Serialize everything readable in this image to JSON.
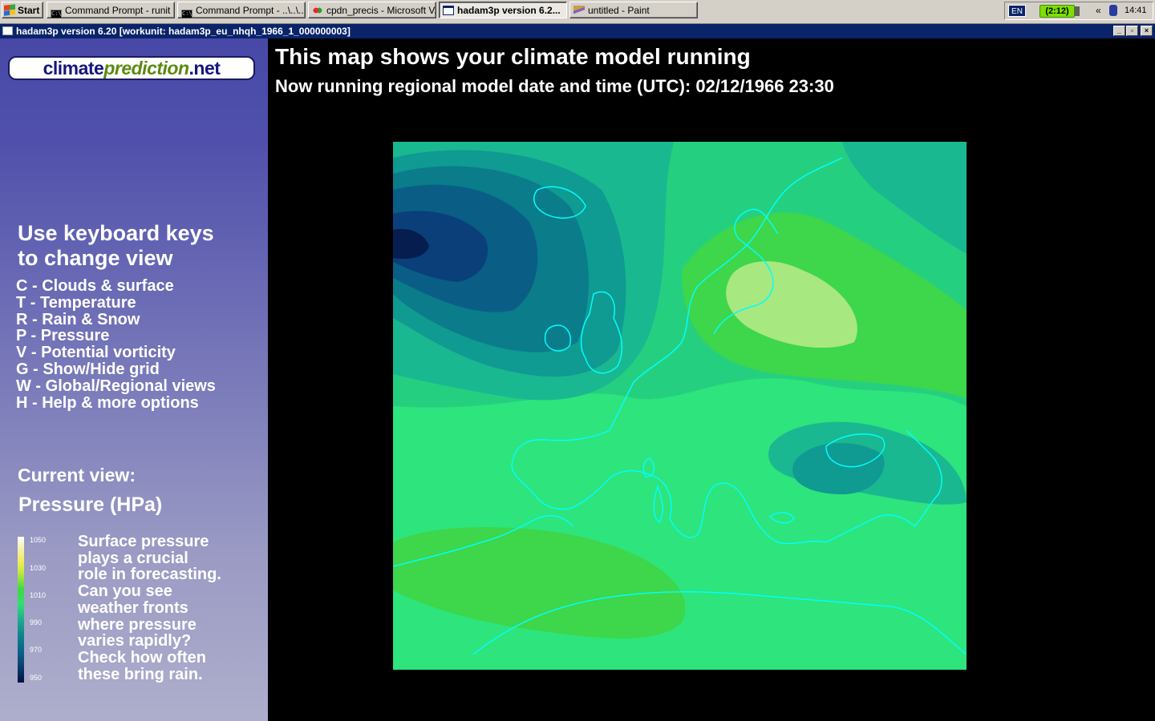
{
  "taskbar": {
    "start_label": "Start",
    "items": [
      {
        "label": "Command Prompt - runit",
        "icon": "cmd-icon"
      },
      {
        "label": "Command Prompt - ..\\..\\...",
        "icon": "cmd-icon"
      },
      {
        "label": "cpdn_precis - Microsoft V...",
        "icon": "app-icon"
      },
      {
        "label": "hadam3p version 6.2...",
        "icon": "window-icon",
        "active": true
      },
      {
        "label": "untitled - Paint",
        "icon": "paint-icon"
      }
    ],
    "tray": {
      "language": "EN",
      "battery": "(2:12)",
      "time": "14:41",
      "chevron": "«"
    }
  },
  "window": {
    "title": "hadam3p version 6.20 [workunit: hadam3p_eu_nhqh_1966_1_000000003]",
    "minimize": "_",
    "maximize": "▫",
    "close": "×"
  },
  "sidebar": {
    "logo_part1": "climate",
    "logo_part2": "prediction",
    "logo_part3": ".net",
    "keyboard_title_line1": "Use keyboard keys",
    "keyboard_title_line2": "to change view",
    "keys": [
      "C - Clouds & surface",
      "T - Temperature",
      "R - Rain & Snow",
      "P - Pressure",
      "V - Potential vorticity",
      "G - Show/Hide grid",
      "W - Global/Regional views",
      "H - Help & more options"
    ],
    "current_view_label": "Current view:",
    "current_view_value": "Pressure (HPa)",
    "legend_ticks": [
      "1050",
      "1030",
      "1010",
      "990",
      "970",
      "950"
    ],
    "description": "Surface pressure\nplays a crucial\nrole in forecasting.\nCan you see\nweather fronts\nwhere pressure\nvaries rapidly?\nCheck how often\nthese bring rain."
  },
  "main": {
    "heading": "This map shows your climate model running",
    "subheading": "Now running regional model date and time (UTC): 02/12/1966 23:30"
  },
  "colors": {
    "title_bar": "#0a246a",
    "coastline": "#00ffff",
    "pressure_low": "#05184a",
    "pressure_mid": "#2ee47c",
    "pressure_high": "#a8e880"
  }
}
